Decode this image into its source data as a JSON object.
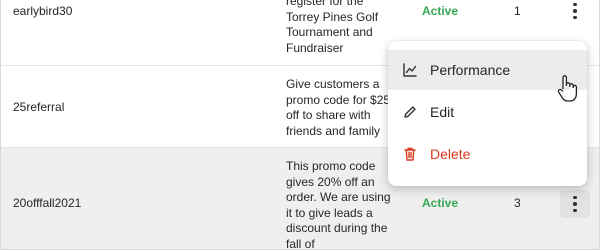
{
  "rows": [
    {
      "code": "earlybird30",
      "description_lines": [
        "register for the",
        "Torrey Pines Golf",
        "Tournament and",
        "Fundraiser"
      ],
      "status": "Active",
      "count": "1"
    },
    {
      "code": "25referral",
      "description_lines": [
        "Give customers a",
        "promo code for $25",
        "off to share with",
        "friends and family"
      ],
      "status": "",
      "count": ""
    },
    {
      "code": "20offfall2021",
      "description_lines": [
        "This promo code",
        "gives 20% off an",
        "order. We are using",
        "it to give leads a",
        "discount during the",
        "fall of"
      ],
      "status": "Active",
      "count": "3"
    }
  ],
  "menu": {
    "items": [
      {
        "label": "Performance",
        "icon": "chart-line-icon"
      },
      {
        "label": "Edit",
        "icon": "pencil-icon"
      },
      {
        "label": "Delete",
        "icon": "trash-icon"
      }
    ]
  },
  "colors": {
    "status_active": "#35a853",
    "danger": "#d9371d",
    "row_highlight": "#efefef"
  }
}
